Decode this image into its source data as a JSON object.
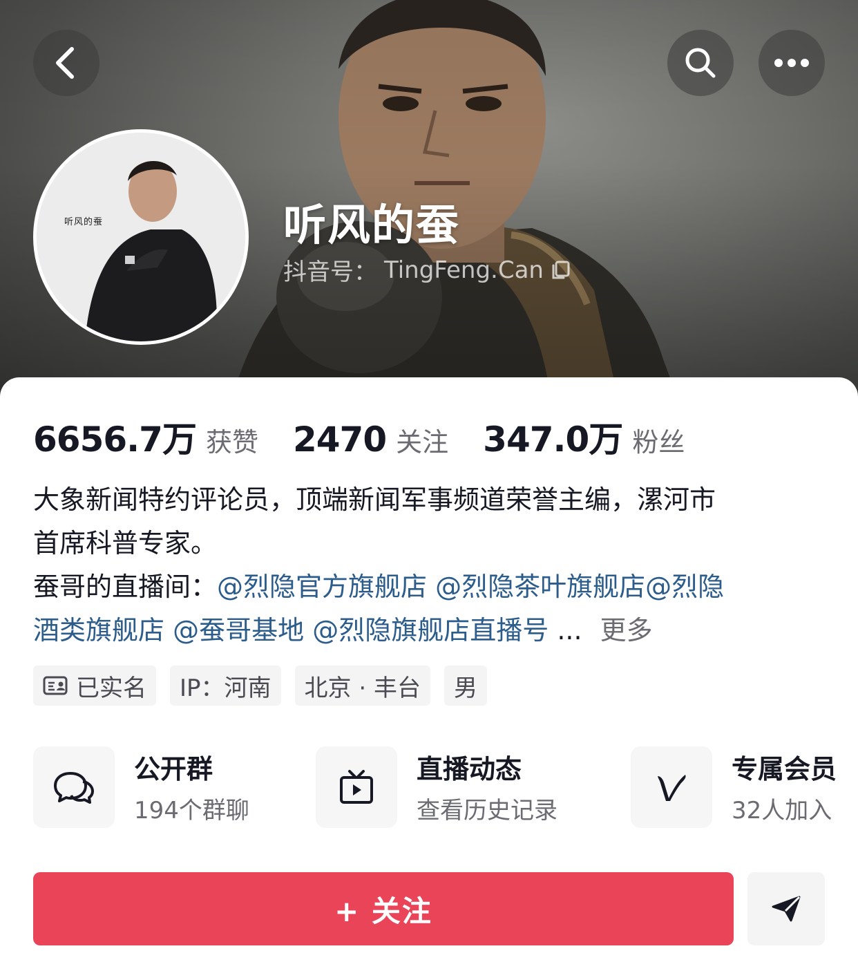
{
  "header": {
    "username": "听风的蚕",
    "douyin_id_label": "抖音号：",
    "douyin_id": "TingFeng.Can",
    "avatar_logo_text": "听风的蚕"
  },
  "stats": [
    {
      "value": "6656.7万",
      "label": "获赞"
    },
    {
      "value": "2470",
      "label": "关注"
    },
    {
      "value": "347.0万",
      "label": "粉丝"
    }
  ],
  "bio": {
    "line1": "大象新闻特约评论员，顶端新闻军事频道荣誉主编，漯河市",
    "line2": "首席科普专家。",
    "line3_prefix": "蚕哥的直播间：",
    "mentions": [
      "@烈隐官方旗舰店",
      "@烈隐茶叶旗舰店",
      "@烈隐",
      "酒类旗舰店",
      "@蚕哥基地",
      "@烈隐旗舰店直播号"
    ],
    "ellipsis": "...",
    "more": "更多"
  },
  "tags": {
    "verified": "已实名",
    "ip": "IP：河南",
    "location": "北京 · 丰台",
    "gender": "男"
  },
  "features": [
    {
      "title": "公开群",
      "subtitle": "194个群聊",
      "icon": "chat-bubbles-icon"
    },
    {
      "title": "直播动态",
      "subtitle": "查看历史记录",
      "icon": "tv-play-icon"
    },
    {
      "title": "专属会员",
      "subtitle": "32人加入",
      "icon": "v-member-icon"
    }
  ],
  "actions": {
    "follow": "+ 关注",
    "share_icon": "send-icon"
  },
  "colors": {
    "follow_button": "#ea4459",
    "mention": "#2b5c8c",
    "text_primary": "#161823",
    "text_secondary": "#6b6c72"
  }
}
